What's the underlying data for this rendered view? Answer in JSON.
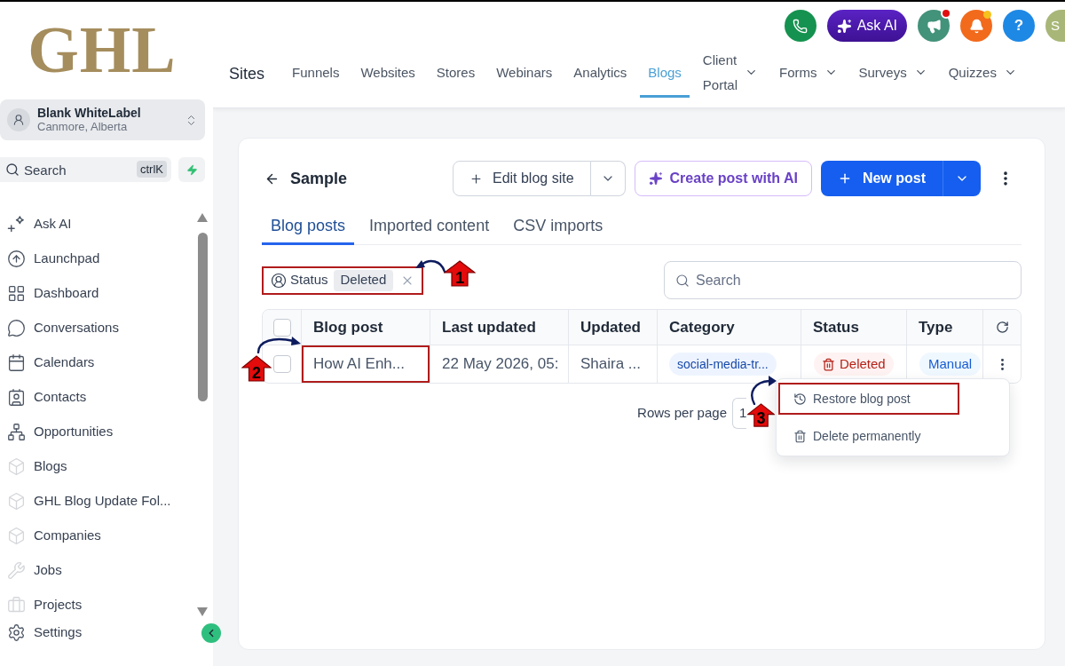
{
  "sidebar": {
    "logo": "GHL",
    "account": {
      "name": "Blank WhiteLabel",
      "location": "Canmore, Alberta"
    },
    "search": {
      "placeholder": "Search",
      "shortcut": "ctrlK"
    },
    "items": [
      {
        "label": "Ask AI"
      },
      {
        "label": "Launchpad"
      },
      {
        "label": "Dashboard"
      },
      {
        "label": "Conversations"
      },
      {
        "label": "Calendars"
      },
      {
        "label": "Contacts"
      },
      {
        "label": "Opportunities"
      },
      {
        "label": "Blogs"
      },
      {
        "label": "GHL Blog Update Fol..."
      },
      {
        "label": "Companies"
      },
      {
        "label": "Jobs"
      },
      {
        "label": "Projects"
      }
    ],
    "settings": {
      "label": "Settings"
    }
  },
  "header": {
    "section": "Sites",
    "tabs": [
      {
        "label": "Funnels",
        "selected": false,
        "has_menu": false
      },
      {
        "label": "Websites",
        "selected": false,
        "has_menu": false
      },
      {
        "label": "Stores",
        "selected": false,
        "has_menu": false
      },
      {
        "label": "Webinars",
        "selected": false,
        "has_menu": false
      },
      {
        "label": "Analytics",
        "selected": false,
        "has_menu": false
      },
      {
        "label": "Blogs",
        "selected": true,
        "has_menu": false
      },
      {
        "label": "Client Portal",
        "selected": false,
        "has_menu": true
      },
      {
        "label": "Forms",
        "selected": false,
        "has_menu": true
      },
      {
        "label": "Surveys",
        "selected": false,
        "has_menu": true
      },
      {
        "label": "Quizzes",
        "selected": false,
        "has_menu": true
      }
    ],
    "tools": [
      {
        "kind": "call"
      },
      {
        "kind": "ask",
        "label": "Ask AI"
      },
      {
        "kind": "news",
        "unread": true
      },
      {
        "kind": "alerts",
        "unread": true
      },
      {
        "kind": "help",
        "label": "?"
      },
      {
        "kind": "avatar",
        "label": "S"
      }
    ]
  },
  "page": {
    "title": "Sample",
    "buttons": [
      {
        "kind": "outline",
        "label": "Edit blog site",
        "split": true
      },
      {
        "kind": "ai",
        "label": "Create post with AI",
        "split": false
      },
      {
        "kind": "primary",
        "label": "New post",
        "split": true
      }
    ],
    "tabs": [
      {
        "label": "Blog posts",
        "selected": true
      },
      {
        "label": "Imported content",
        "selected": false
      },
      {
        "label": "CSV imports",
        "selected": false
      }
    ],
    "filter": {
      "field": "Status",
      "value": "Deleted",
      "callout": "1"
    },
    "search": {
      "placeholder": "Search"
    },
    "table": {
      "select_all": false,
      "columns": [
        "Blog post",
        "Last updated",
        "Updated",
        "Category",
        "Status",
        "Type"
      ],
      "rows": [
        {
          "checked": false,
          "title": "How AI Enh...",
          "title_callout": "2",
          "last_updated": "22 May 2026, 05:",
          "updated_by": "Shaira ...",
          "category": "social-media-tr...",
          "status": {
            "kind": "deleted",
            "label": "Deleted"
          },
          "type": "Manual"
        }
      ]
    },
    "row_menu": {
      "items": [
        {
          "kind": "restore",
          "label": "Restore blog post",
          "callout": "3"
        },
        {
          "kind": "delete",
          "label": "Delete permanently"
        }
      ]
    },
    "pagination": {
      "label": "Rows per page",
      "page_size": "1"
    }
  }
}
